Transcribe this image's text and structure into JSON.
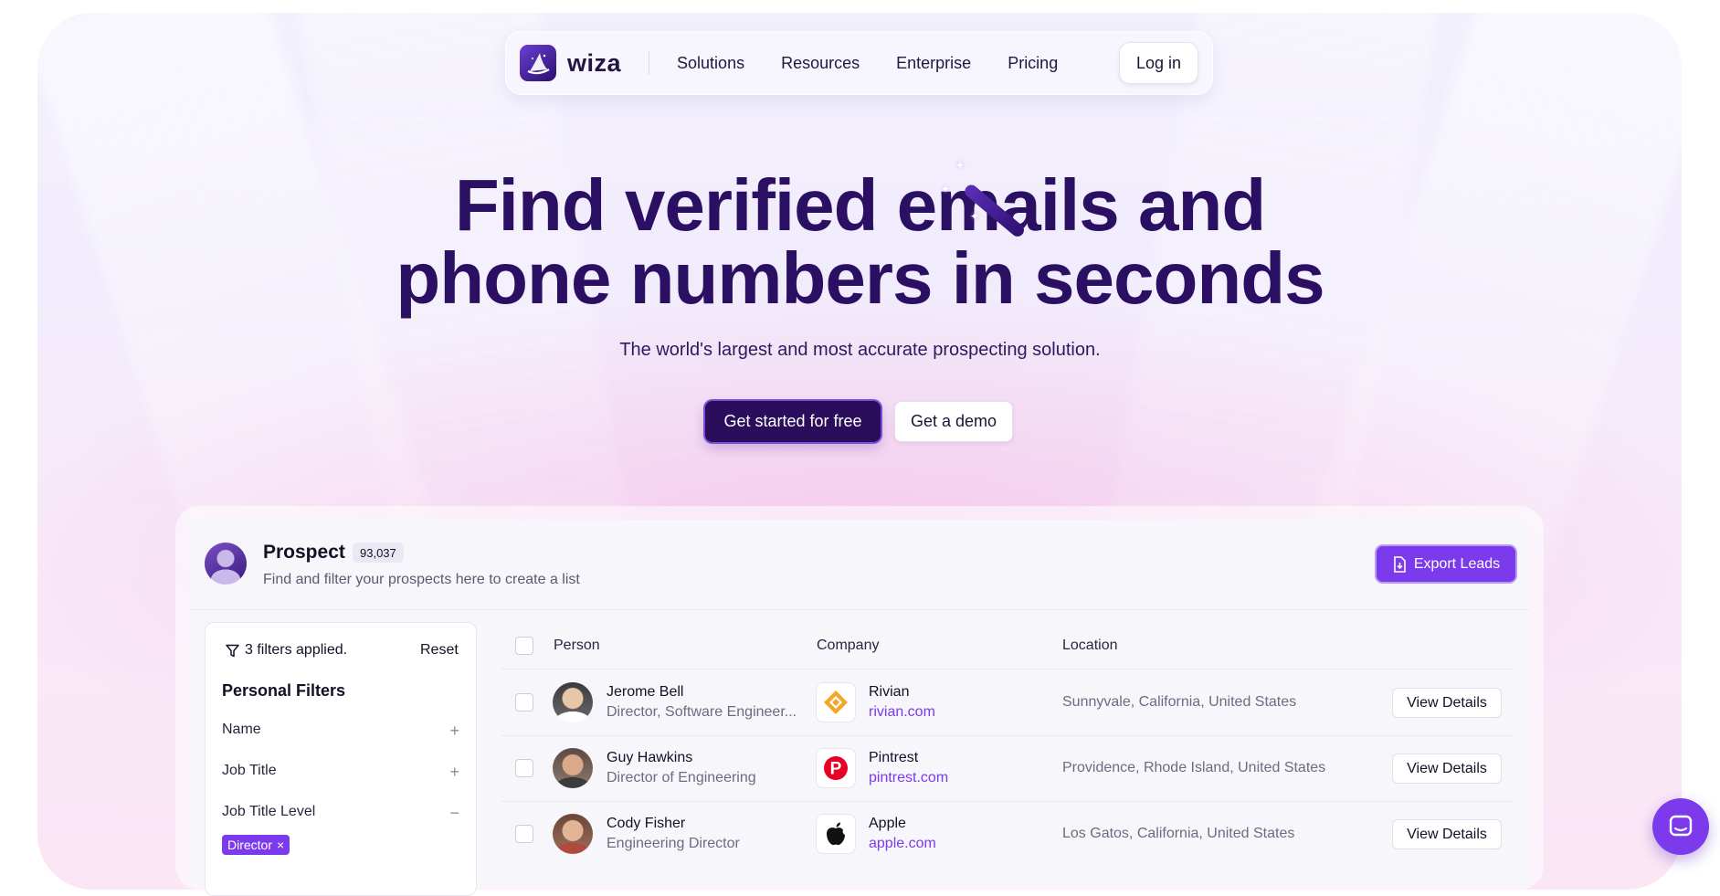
{
  "nav": {
    "logo_text": "wiza",
    "links": [
      "Solutions",
      "Resources",
      "Enterprise",
      "Pricing"
    ],
    "login_label": "Log in"
  },
  "hero": {
    "title_line1": "Find verified emails and",
    "title_line2": "phone numbers in seconds",
    "subtitle": "The world's largest and most accurate prospecting solution.",
    "primary_cta": "Get started for free",
    "secondary_cta": "Get a demo"
  },
  "prospect": {
    "title": "Prospect",
    "count": "93,037",
    "description": "Find and filter your prospects here to create a list",
    "export_label": "Export Leads"
  },
  "filters": {
    "applied_label": "3 filters applied.",
    "reset_label": "Reset",
    "section_title": "Personal Filters",
    "rows": [
      {
        "label": "Name",
        "sign": "+"
      },
      {
        "label": "Job Title",
        "sign": "+"
      },
      {
        "label": "Job Title Level",
        "sign": "−"
      }
    ],
    "chip_label": "Director",
    "chip_remove": "×"
  },
  "table": {
    "headers": {
      "person": "Person",
      "company": "Company",
      "location": "Location"
    },
    "rows": [
      {
        "name": "Jerome Bell",
        "title": "Director, Software Engineer...",
        "company": "Rivian",
        "site": "rivian.com",
        "location": "Sunnyvale, California, United States",
        "action": "View Details"
      },
      {
        "name": "Guy Hawkins",
        "title": "Director of Engineering",
        "company": "Pintrest",
        "site": "pintrest.com",
        "location": "Providence, Rhode Island, United States",
        "action": "View Details"
      },
      {
        "name": "Cody Fisher",
        "title": "Engineering Director",
        "company": "Apple",
        "site": "apple.com",
        "location": "Los Gatos, California, United States",
        "action": "View Details"
      }
    ]
  },
  "colors": {
    "brand_dark": "#2a0f63",
    "accent": "#7c3aed",
    "link": "#7c3aed"
  },
  "icons": [
    "wizard-hat-icon",
    "magic-wand-icon",
    "filter-icon",
    "export-file-icon",
    "plus-icon",
    "minus-icon",
    "rivian-logo-icon",
    "pinterest-logo-icon",
    "apple-logo-icon",
    "chat-icon"
  ]
}
